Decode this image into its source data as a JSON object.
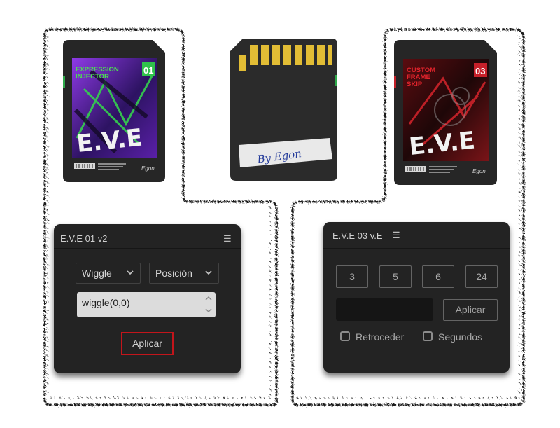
{
  "cards": [
    {
      "side": "front",
      "tag": "EXPRESSION INJECTOR",
      "tag_lines": [
        "EXPRESSION",
        "INJECTOR"
      ],
      "number": "01",
      "logo": "E.V.E",
      "accent": "#3bd44a",
      "art_colors": [
        "#7a2fd8",
        "#2a1160",
        "#28c24a"
      ]
    },
    {
      "side": "back",
      "signature": "By Egon",
      "contact_color": "#e8c233"
    },
    {
      "side": "front",
      "tag": "CUSTOM FRAME SKIP",
      "tag_lines": [
        "CUSTOM",
        "FRAME",
        "SKIP"
      ],
      "number": "03",
      "logo": "E.V.E",
      "accent": "#d8242c",
      "art_colors": [
        "#6a1014",
        "#2a0a0c",
        "#c01c22"
      ]
    }
  ],
  "panel1": {
    "title": "E.V.E 01 v2",
    "menu_icon": "hamburger-menu-icon",
    "dropdown_effect": "Wiggle",
    "dropdown_property": "Posición",
    "expression_value": "wiggle(0,0)",
    "apply_label": "Aplicar",
    "apply_border_color": "#c3151b"
  },
  "panel2": {
    "title": "E.V.E 03 v.E",
    "menu_icon": "hamburger-menu-icon",
    "frame_buttons": [
      "3",
      "5",
      "6",
      "24"
    ],
    "custom_frames_value": "",
    "apply_label": "Aplicar",
    "reverse_label": "Retroceder",
    "seconds_label": "Segundos"
  }
}
